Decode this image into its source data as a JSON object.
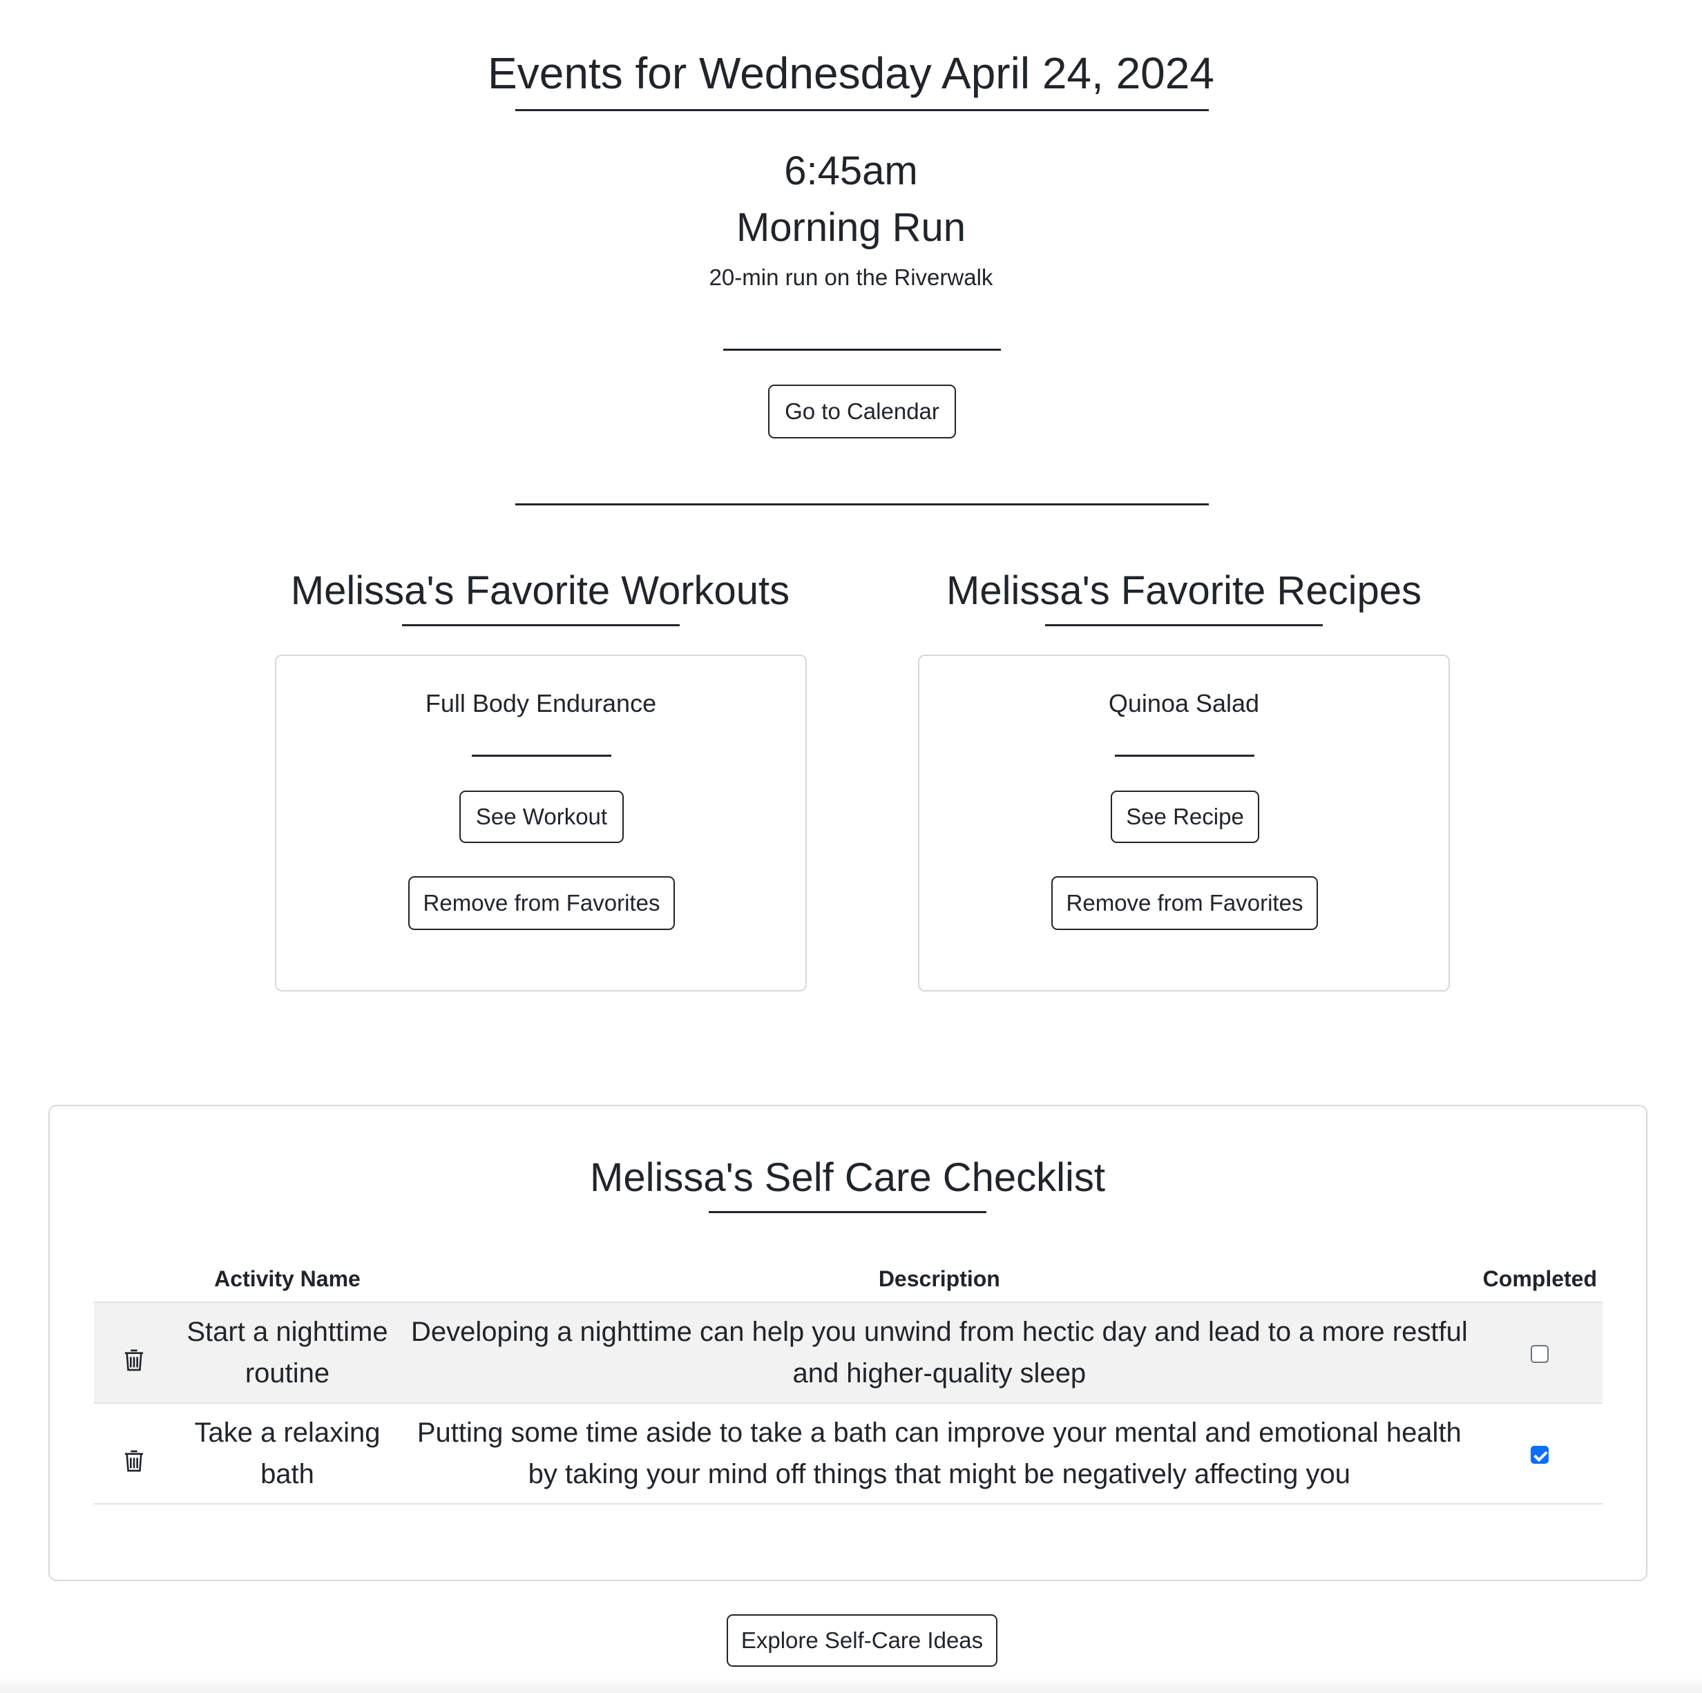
{
  "events": {
    "heading": "Events for Wednesday April 24, 2024",
    "time": "6:45am",
    "title": "Morning Run",
    "description": "20-min run on the Riverwalk",
    "calendar_button": "Go to Calendar"
  },
  "workouts": {
    "heading": "Melissa's Favorite Workouts",
    "card_title": "Full Body Endurance",
    "see_button": "See Workout",
    "remove_button": "Remove from Favorites"
  },
  "recipes": {
    "heading": "Melissa's Favorite Recipes",
    "card_title": "Quinoa Salad",
    "see_button": "See Recipe",
    "remove_button": "Remove from Favorites"
  },
  "checklist": {
    "heading": "Melissa's Self Care Checklist",
    "columns": [
      "Activity Name",
      "Description",
      "Completed"
    ],
    "rows": [
      {
        "name": "Start a nighttime routine",
        "description": "Developing a nighttime can help you unwind from hectic day and lead to a more restful and higher-quality sleep",
        "completed": false
      },
      {
        "name": "Take a relaxing bath",
        "description": "Putting some time aside to take a bath can improve your mental and emotional health by taking your mind off things that might be negatively affecting you",
        "completed": true
      }
    ]
  },
  "explore_button": "Explore Self-Care Ideas",
  "icons": {
    "delete": "trash-icon",
    "completed": "checkbox-icon"
  },
  "colors": {
    "text": "#212529",
    "checkbox_checked": "#0d6efd",
    "row_stripe": "#f2f2f2",
    "border": "#d6d8db"
  }
}
